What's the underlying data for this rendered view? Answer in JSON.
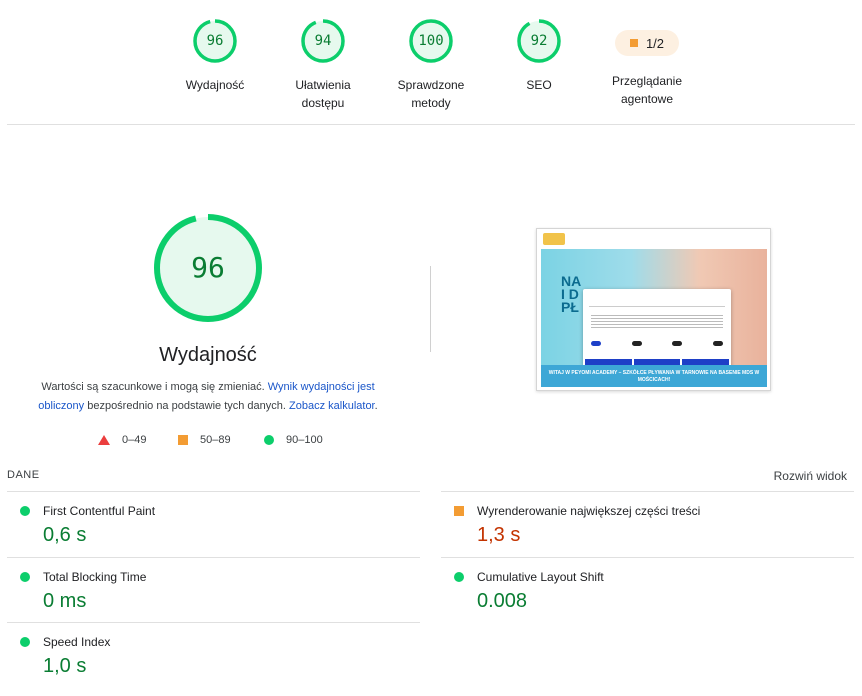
{
  "summary": {
    "gauges": [
      {
        "score": "96",
        "label_line1": "Wydajność",
        "label_line2": ""
      },
      {
        "score": "94",
        "label_line1": "Ułatwienia",
        "label_line2": "dostępu"
      },
      {
        "score": "100",
        "label_line1": "Sprawdzone",
        "label_line2": "metody"
      },
      {
        "score": "92",
        "label_line1": "SEO",
        "label_line2": ""
      }
    ],
    "agent": {
      "value": "1/2",
      "label_line1": "Przeglądanie",
      "label_line2": "agentowe"
    }
  },
  "performance": {
    "score": "96",
    "title": "Wydajność",
    "desc_part1": "Wartości są szacunkowe i mogą się zmieniać. ",
    "desc_link1": "Wynik wydajności jest obliczony",
    "desc_part2": " bezpośrednio na podstawie tych danych. ",
    "desc_link2": "Zobacz kalkulator",
    "desc_end": "."
  },
  "legend": {
    "fail": "0–49",
    "average": "50–89",
    "pass": "90–100"
  },
  "thumbnail": {
    "big_letters": "NA\nI D\nPŁ",
    "hero_text": "WITAJ W PEYOMI ACADEMY – SZKÓŁCE PŁYWANIA W TARNOWIE NA BASENIE MDS W MOŚCICACH!"
  },
  "metrics_section": {
    "label": "DANE",
    "expand": "Rozwiń widok",
    "items": [
      {
        "name": "First Contentful Paint",
        "value": "0,6 s",
        "rating": "pass"
      },
      {
        "name": "Wyrenderowanie największej części treści",
        "value": "1,3 s",
        "rating": "average"
      },
      {
        "name": "Total Blocking Time",
        "value": "0 ms",
        "rating": "pass"
      },
      {
        "name": "Cumulative Layout Shift",
        "value": "0.008",
        "rating": "pass"
      },
      {
        "name": "Speed Index",
        "value": "1,0 s",
        "rating": "pass"
      }
    ]
  },
  "colors": {
    "pass": "#0cce6b",
    "pass_text": "#0a7d33",
    "average": "#f39c33",
    "average_text": "#c33300",
    "fail": "#eb3e3e",
    "link": "#1a56c9"
  }
}
